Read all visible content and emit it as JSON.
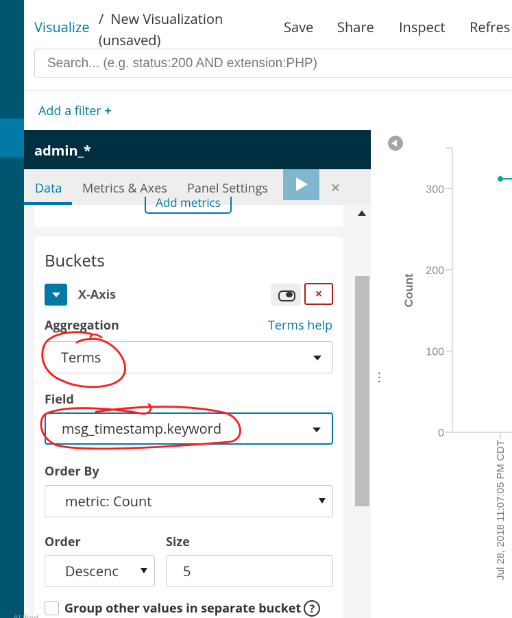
{
  "header": {
    "breadcrumb": "Visualize",
    "title_line1": "New Visualization",
    "title_line2": "(unsaved)",
    "separator": "/",
    "menu": [
      "Save",
      "Share",
      "Inspect",
      "Refres"
    ]
  },
  "search": {
    "placeholder": "Search... (e.g. status:200 AND extension:PHP)"
  },
  "filter": {
    "add_label": "Add a filter"
  },
  "editor": {
    "index_pattern": "admin_*",
    "tabs": [
      "Data",
      "Metrics & Axes",
      "Panel Settings"
    ],
    "add_metrics": "Add metrics",
    "buckets_title": "Buckets",
    "bucket_type": "X-Axis",
    "aggregation_label": "Aggregation",
    "aggregation_help": "Terms help",
    "aggregation_value": "Terms",
    "field_label": "Field",
    "field_value": "msg_timestamp.keyword",
    "order_by_label": "Order By",
    "order_by_value": "metric: Count",
    "order_label": "Order",
    "order_value": "Descenc",
    "size_label": "Size",
    "size_value": "5",
    "group_other": "Group other values in separate bucket"
  },
  "chart_data": {
    "type": "line",
    "ylabel": "Count",
    "yticks": [
      0,
      100,
      200,
      300
    ],
    "ylim": [
      0,
      350
    ],
    "x": [
      "Jul 28, 2018 11:07:05 PM CDT"
    ],
    "series": [
      {
        "values": [
          312
        ]
      }
    ],
    "color": "#00a69b"
  },
  "footer": {
    "text": "#Liked"
  }
}
